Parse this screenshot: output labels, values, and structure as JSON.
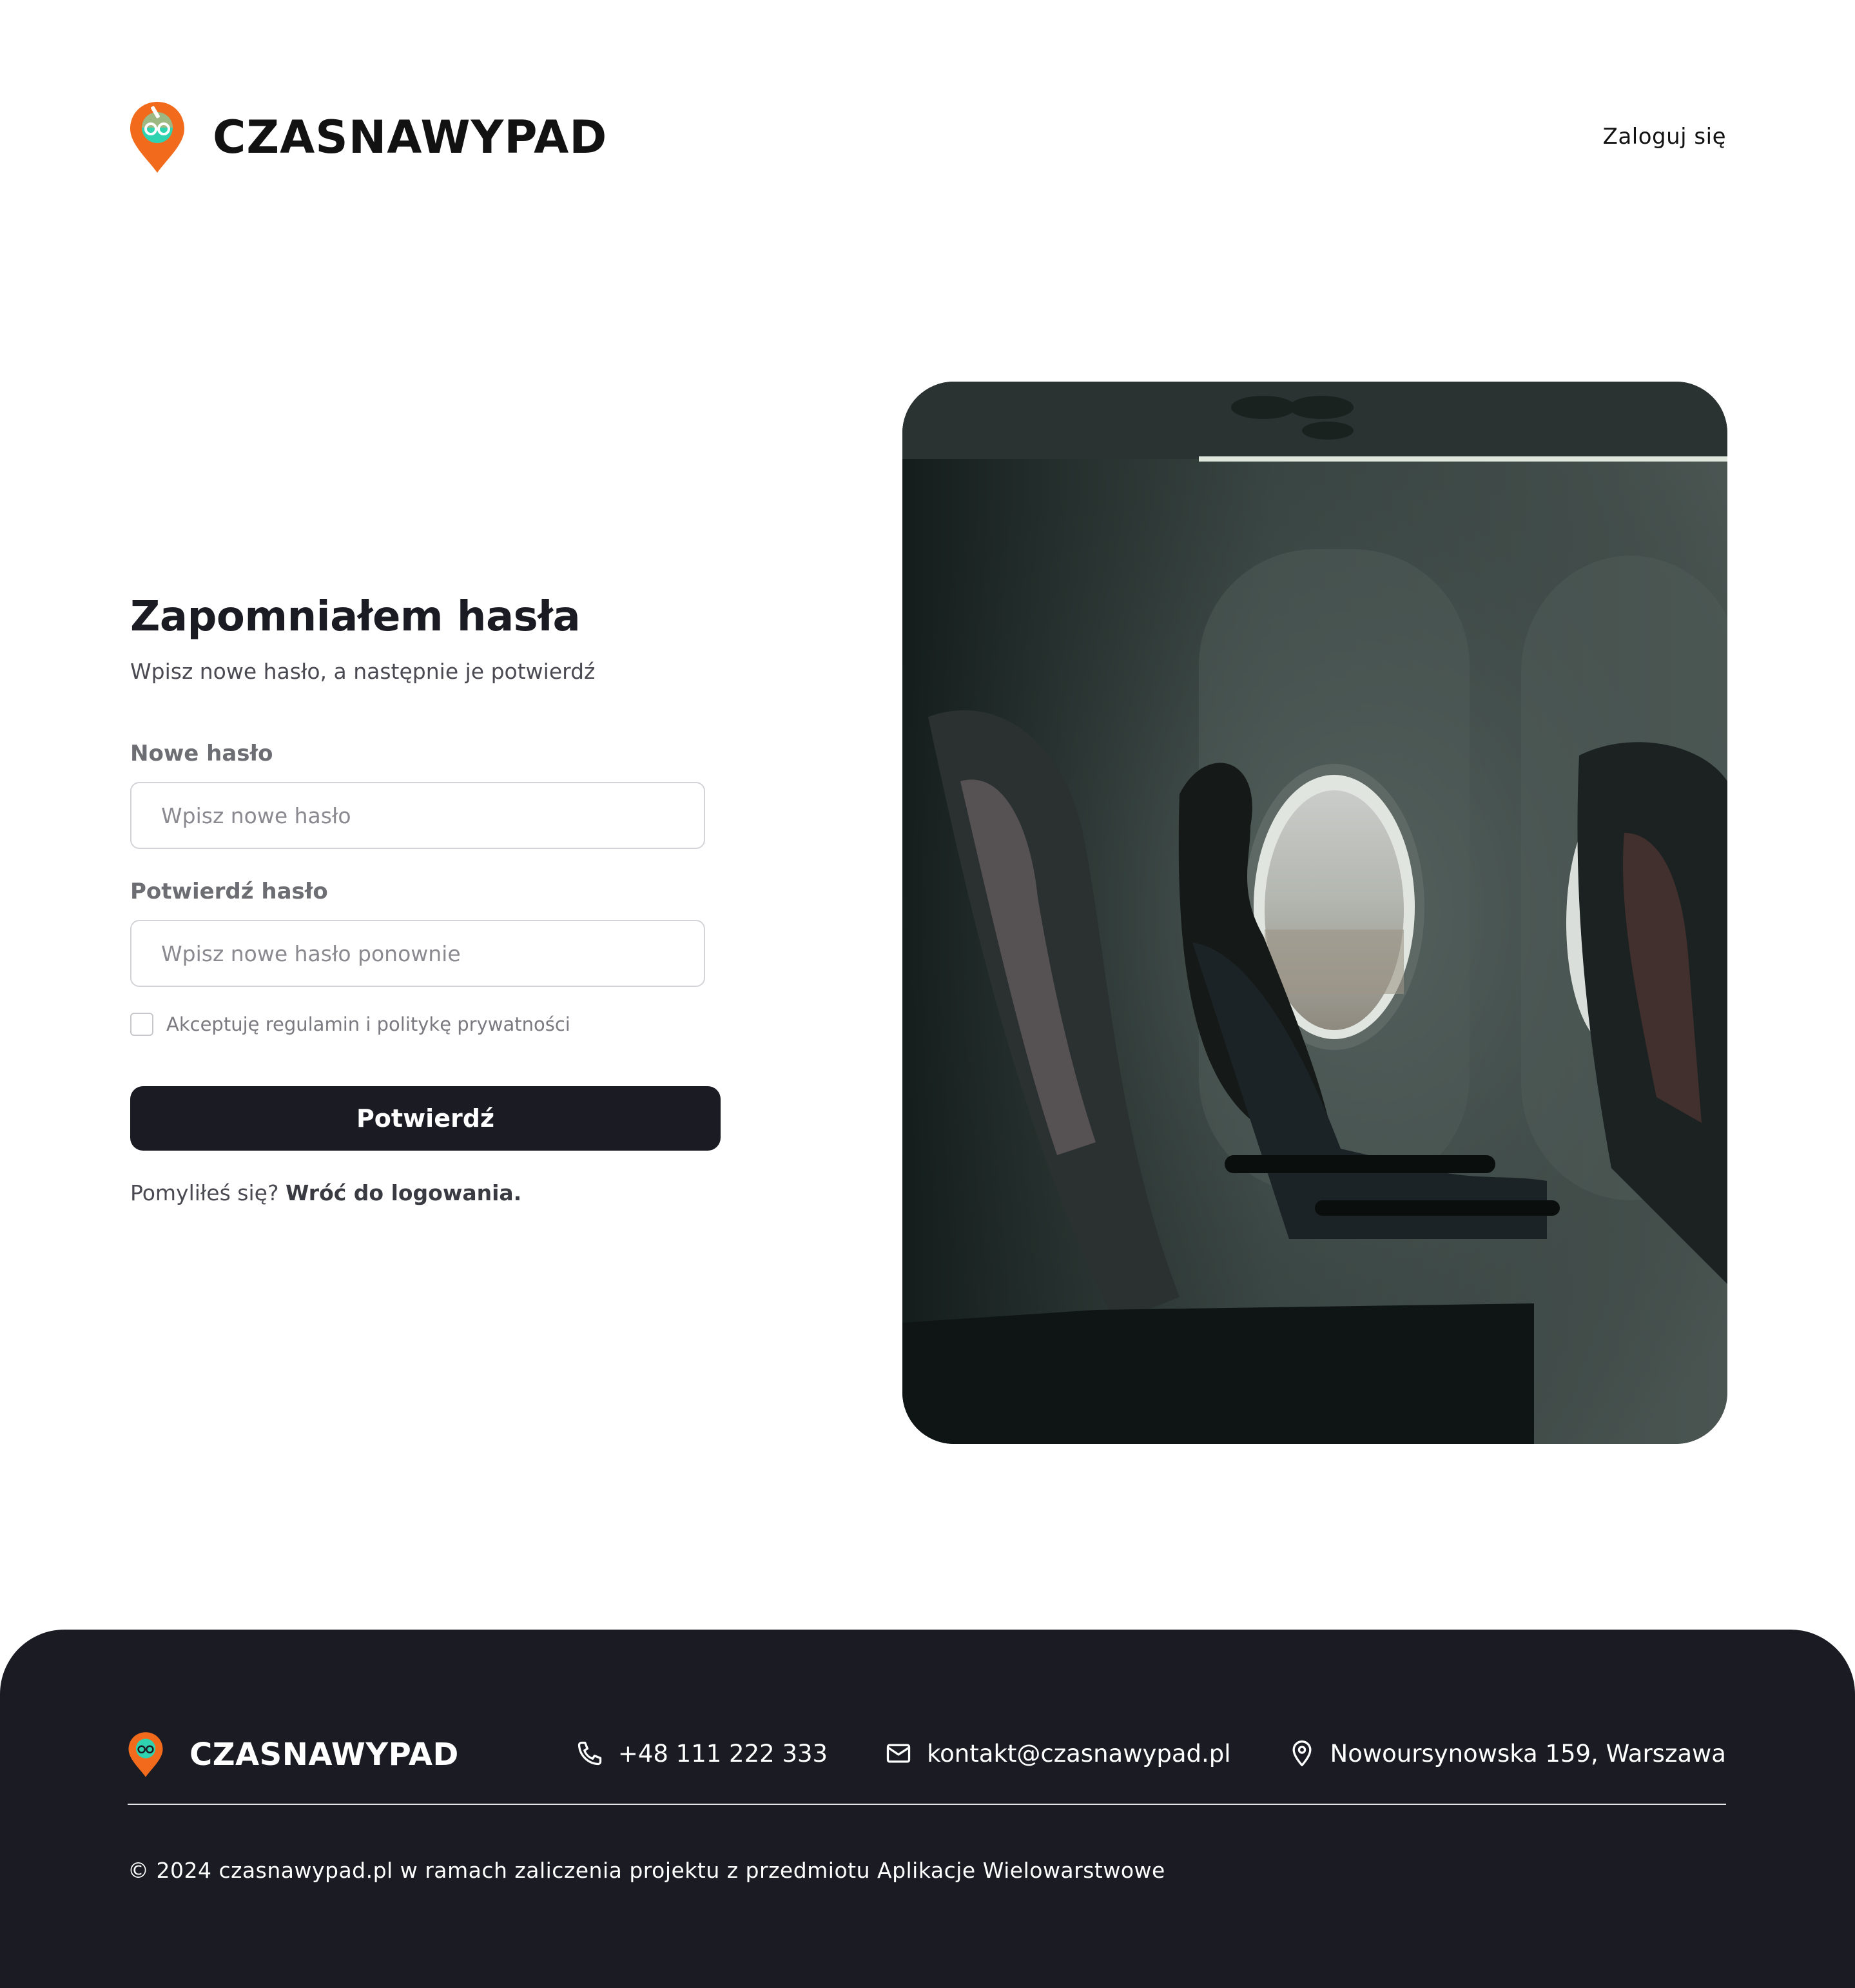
{
  "header": {
    "brand": "CZASNAWYPAD",
    "login_link": "Zaloguj się"
  },
  "form": {
    "title": "Zapomniałem hasła",
    "subtitle": "Wpisz nowe hasło, a następnie je potwierdź",
    "new_password": {
      "label": "Nowe hasło",
      "placeholder": "Wpisz nowe hasło",
      "value": ""
    },
    "confirm_password": {
      "label": "Potwierdź hasło",
      "placeholder": "Wpisz nowe hasło ponownie",
      "value": ""
    },
    "terms_label": "Akceptuję regulamin i politykę prywatności",
    "terms_checked": false,
    "submit_label": "Potwierdź",
    "back_prefix": "Pomyliłeś się?",
    "back_link": "Wróć do logowania."
  },
  "footer": {
    "brand": "CZASNAWYPAD",
    "phone": "+48 111 222 333",
    "email": "kontakt@czasnawypad.pl",
    "address": "Nowoursynowska 159, Warszawa",
    "copyright": "© 2024 czasnawypad.pl w ramach zaliczenia projektu z przedmiotu Aplikacje Wielowarstwowe"
  },
  "icons": {
    "brand_logo": "map-pin-glasses-icon",
    "phone": "phone-icon",
    "email": "mail-icon",
    "address": "map-pin-icon"
  },
  "colors": {
    "accent_orange": "#f26b1d",
    "accent_teal": "#2fd3b0",
    "dark": "#1b1b24",
    "background": "#ffffff"
  }
}
